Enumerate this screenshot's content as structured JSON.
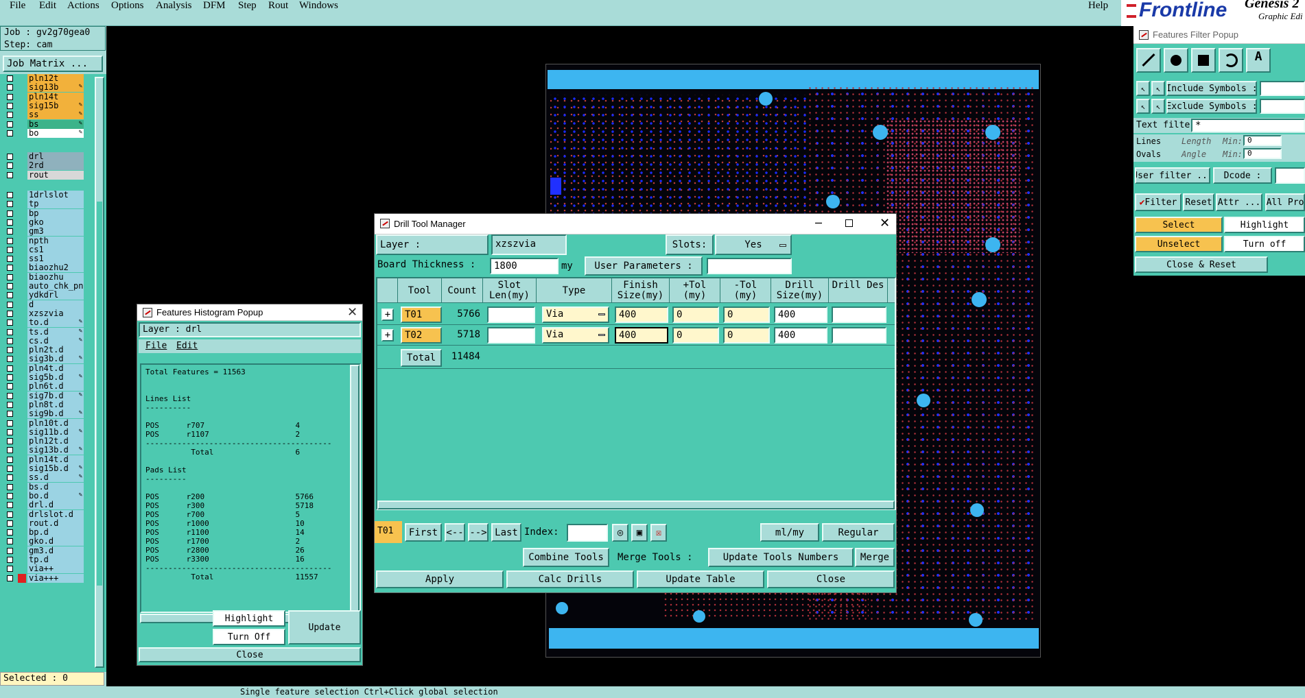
{
  "menu": [
    "File",
    "Edit",
    "Actions",
    "Options",
    "Analysis",
    "DFM",
    "Step",
    "Rout",
    "Windows"
  ],
  "help": "Help",
  "brand": {
    "name": "Frontline",
    "product": "Genesis 2",
    "subtitle": "Graphic Edi"
  },
  "job": {
    "job": "Job : gv2g70gea0",
    "step": "Step: cam",
    "matrix": "Job Matrix ...",
    "selected": "Selected : 0"
  },
  "layers_a": [
    "pln12t",
    "sig13b",
    "pln14t",
    "sig15b",
    "ss",
    "bs",
    "bo"
  ],
  "layers_b": [
    "drl",
    "2rd",
    "rout"
  ],
  "layers_c": [
    "1drlslot",
    "tp",
    "bp",
    "gko",
    "gm3",
    "npth",
    "cs1",
    "ss1",
    "biaozhu2",
    "biaozhu",
    "auto_chk_pn",
    "ydkdrl",
    "d",
    "xzszvia",
    "to.d",
    "ts.d",
    "cs.d",
    "pln2t.d",
    "sig3b.d",
    "pln4t.d",
    "sig5b.d",
    "pln6t.d",
    "sig7b.d",
    "pln8t.d",
    "sig9b.d",
    "pln10t.d",
    "sig11b.d",
    "pln12t.d",
    "sig13b.d",
    "pln14t.d",
    "sig15b.d",
    "ss.d",
    "bs.d",
    "bo.d",
    "drl.d",
    "drlslot.d",
    "rout.d",
    "bp.d",
    "gko.d",
    "gm3.d",
    "tp.d",
    "via++",
    "via+++"
  ],
  "histogram": {
    "title": "Features Histogram Popup",
    "layer": "Layer :  drl",
    "menu": [
      "File",
      "Edit"
    ],
    "text": "Total Features = 11563\n\n\nLines List\n----------\n\nPOS      r707                    4\nPOS      r1107                   2\n-----------------------------------------\n          Total                  6\n\nPads List\n---------\n\nPOS      r200                    5766\nPOS      r300                    5718\nPOS      r700                    5\nPOS      r1000                   10\nPOS      r1100                   14\nPOS      r1700                   2\nPOS      r2800                   26\nPOS      r3300                   16\n-----------------------------------------\n          Total                  11557",
    "highlight": "Highlight",
    "turn_off": "Turn Off",
    "update": "Update",
    "close": "Close"
  },
  "drill": {
    "title": "Drill Tool Manager",
    "layer_label": "Layer          :",
    "layer_value": "xzszvia",
    "slots_label": "Slots:",
    "slots_value": "Yes",
    "thickness_label": "Board Thickness :",
    "thickness_value": "1800",
    "thickness_unit": "my",
    "user_params": "User Parameters :",
    "headers": [
      "Tool",
      "Count",
      "Slot Len(my)",
      "Type",
      "Finish Size(my)",
      "+Tol (my)",
      "-Tol (my)",
      "Drill Size(my)",
      "Drill Des"
    ],
    "rows": [
      {
        "tool": "T01",
        "count": "5766",
        "type": "Via",
        "finish": "400",
        "ptol": "0",
        "mtol": "0",
        "drill": "400"
      },
      {
        "tool": "T02",
        "count": "5718",
        "type": "Via",
        "finish": "400",
        "ptol": "0",
        "mtol": "0",
        "drill": "400"
      }
    ],
    "total_label": "Total",
    "total_count": "11484",
    "nav": {
      "current": "T01",
      "first": "First",
      "prev": "<--",
      "next": "-->",
      "last": "Last",
      "index": "Index:",
      "units": "ml/my",
      "mode": "Regular"
    },
    "combine": "Combine Tools",
    "merge_tools": "Merge Tools :",
    "merge_mode": "Update Tools Numbers",
    "merge": "Merge",
    "apply": "Apply",
    "calc": "Calc Drills",
    "update_table": "Update Table",
    "close": "Close"
  },
  "filter": {
    "title": "Features Filter Popup",
    "include": "Include Symbols :",
    "exclude": "Exclude Symbols :",
    "text_filter": "Text filter",
    "text_value": "*",
    "lines": "Lines",
    "ovals": "Ovals",
    "length": "Length",
    "angle": "Angle",
    "min": "Min:",
    "min_val": "0",
    "user_filter": "User filter ...",
    "dcode": "Dcode :",
    "filter": "Filter",
    "reset": "Reset",
    "attr": "Attr ...",
    "all_pro": "All Pro",
    "select": "Select",
    "highlight": "Highlight",
    "unselect": "Unselect",
    "turn_off": "Turn off",
    "close_reset": "Close & Reset"
  },
  "status": {
    "msg": "Single feature selection  Ctrl+Click  global selection"
  }
}
